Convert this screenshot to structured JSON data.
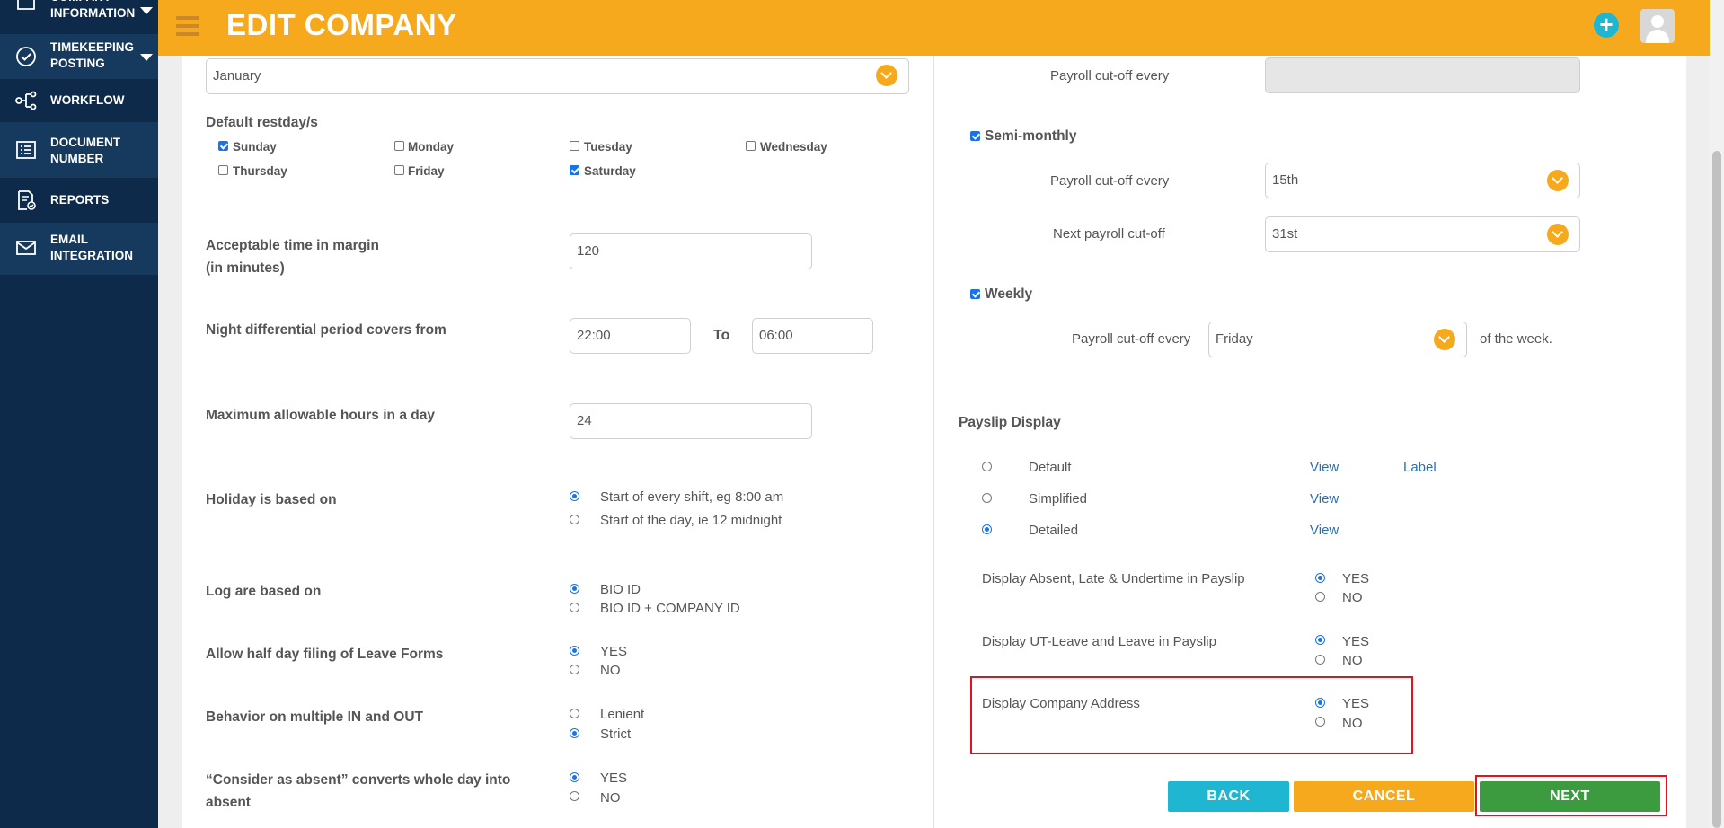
{
  "sidebar": {
    "items": [
      {
        "label": "Company\nInformation",
        "icon": "folder-icon"
      },
      {
        "label": "Timekeeping\nPosting",
        "icon": "check-circle-icon"
      },
      {
        "label": "Workflow",
        "icon": "workflow-icon"
      },
      {
        "label": "Document\nNumber",
        "icon": "document-list-icon"
      },
      {
        "label": "Reports",
        "icon": "report-icon"
      },
      {
        "label": "Email\nIntegration",
        "icon": "mail-icon"
      }
    ]
  },
  "header": {
    "title": "EDIT COMPANY",
    "color": "#f7a91e"
  },
  "left": {
    "month_select": "January",
    "restday_label": "Default restday/s",
    "restdays": [
      {
        "label": "Sunday",
        "checked": true
      },
      {
        "label": "Monday",
        "checked": false
      },
      {
        "label": "Tuesday",
        "checked": false
      },
      {
        "label": "Wednesday",
        "checked": false
      },
      {
        "label": "Thursday",
        "checked": false
      },
      {
        "label": "Friday",
        "checked": false
      },
      {
        "label": "Saturday",
        "checked": true
      }
    ],
    "margin_label": "Acceptable time in margin\n(in minutes)",
    "margin_value": "120",
    "night_label": "Night differential period covers from",
    "night_from": "22:00",
    "night_to_label": "To",
    "night_to": "06:00",
    "max_hours_label": "Maximum allowable hours in a day",
    "max_hours_value": "24",
    "holiday_label": "Holiday is based on",
    "holiday_opt1": "Start of every shift, eg 8:00 am",
    "holiday_opt2": "Start of the day, ie 12 midnight",
    "log_label": "Log are based on",
    "log_opt1": "BIO ID",
    "log_opt2": "BIO ID + COMPANY ID",
    "halfday_label": "Allow half day filing of Leave Forms",
    "halfday_yes": "YES",
    "halfday_no": "NO",
    "behavior_label": "Behavior on multiple IN and OUT",
    "behavior_opt1": "Lenient",
    "behavior_opt2": "Strict",
    "absent_label": "“Consider as absent” converts whole day into\nabsent",
    "absent_yes": "YES",
    "absent_no": "NO"
  },
  "right": {
    "cutoff_label_1": "Payroll cut-off every",
    "semi_monthly_label": "Semi-monthly",
    "semi_cutoff_label": "Payroll cut-off every",
    "semi_cutoff_value": "15th",
    "next_cutoff_label": "Next payroll cut-off",
    "next_cutoff_value": "31st",
    "weekly_label": "Weekly",
    "weekly_cutoff_label": "Payroll cut-off every",
    "weekly_cutoff_value": "Friday",
    "weekly_suffix": "of the week.",
    "payslip_label": "Payslip Display",
    "payslip_options": [
      {
        "label": "Default",
        "view": "View",
        "extra": "Label",
        "selected": false
      },
      {
        "label": "Simplified",
        "view": "View",
        "extra": "",
        "selected": false
      },
      {
        "label": "Detailed",
        "view": "View",
        "extra": "",
        "selected": true
      }
    ],
    "absent_late_label": "Display Absent, Late & Undertime in Payslip",
    "ut_leave_label": "Display UT-Leave and Leave in Payslip",
    "company_address_label": "Display Company Address",
    "yes": "YES",
    "no": "NO"
  },
  "buttons": {
    "back": "BACK",
    "cancel": "CANCEL",
    "next": "NEXT"
  },
  "colors": {
    "back": "#1fb6d1",
    "cancel": "#f7a91e",
    "next": "#3c9a3f",
    "highlight": "#e0141e"
  }
}
